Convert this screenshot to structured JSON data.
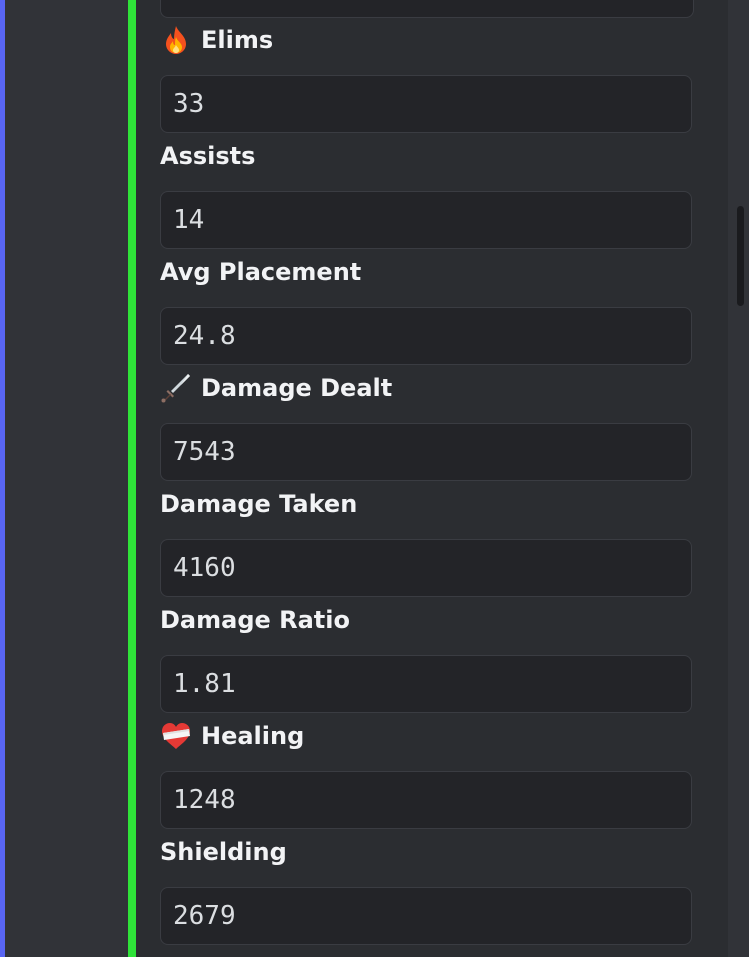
{
  "colors": {
    "background": "#313338",
    "embed_background": "#2b2d31",
    "embed_accent": "#2fe339",
    "left_accent": "#5865f2",
    "field_box": "#232428",
    "label_text": "#f2f3f5",
    "value_text": "#dbdee1"
  },
  "fields": [
    {
      "label": "Elims",
      "value": "33",
      "icon": "fire-icon"
    },
    {
      "label": "Assists",
      "value": "14",
      "icon": ""
    },
    {
      "label": "Avg Placement",
      "value": "24.8",
      "icon": ""
    },
    {
      "label": "Damage Dealt",
      "value": "7543",
      "icon": "dagger-icon"
    },
    {
      "label": "Damage Taken",
      "value": "4160",
      "icon": ""
    },
    {
      "label": "Damage Ratio",
      "value": "1.81",
      "icon": ""
    },
    {
      "label": "Healing",
      "value": "1248",
      "icon": "mending-heart-icon"
    },
    {
      "label": "Shielding",
      "value": "2679",
      "icon": ""
    }
  ]
}
